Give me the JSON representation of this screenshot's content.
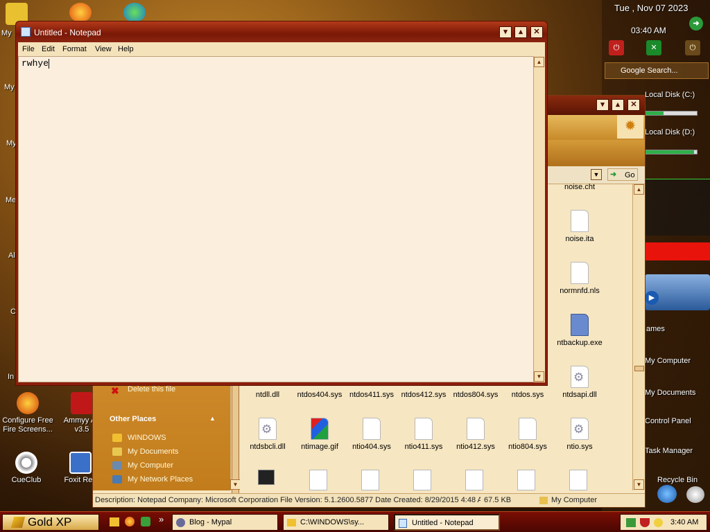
{
  "desktop": {
    "icons_left": [
      {
        "label": "My",
        "icon": "my-documents-icon"
      },
      {
        "label": "My",
        "icon": "my-computer-icon"
      },
      {
        "label": "My",
        "icon": "my-network-icon"
      },
      {
        "label": "Me",
        "icon": "media-icon"
      },
      {
        "label": "Al",
        "icon": "app-icon"
      },
      {
        "label": "C",
        "icon": "app-icon"
      },
      {
        "label": "In",
        "icon": "internet-icon"
      }
    ],
    "configure_fire": "Configure Free\nFire Screens...",
    "ammyy": "Ammyy Ad\nv3.5",
    "cueclub": "CueClub",
    "foxit": "Foxit Rea"
  },
  "sidebar": {
    "date": "Tue , Nov 07 2023",
    "time": "03:40 AM",
    "google_search": "Google Search...",
    "disk_c": "Local Disk (C:)",
    "disk_c_fill": 0.35,
    "disk_d": "Local Disk (D:)",
    "disk_d_fill": 0.95,
    "links": [
      "ames",
      "My Computer",
      "My Documents",
      "Control Panel",
      "Task Manager",
      "Recycle Bin"
    ]
  },
  "explorer": {
    "go_label": "Go",
    "tasks": {
      "delete_file": "Delete this file",
      "other_places_heading": "Other Places",
      "other_places": [
        "WINDOWS",
        "My Documents",
        "My Computer",
        "My Network Places"
      ]
    },
    "files_right_column": [
      {
        "name": "noise.cht",
        "kind": "doc"
      },
      {
        "name": "noise.ita",
        "kind": "doc"
      },
      {
        "name": "normnfd.nls",
        "kind": "doc"
      },
      {
        "name": "ntbackup.exe",
        "kind": "exe"
      }
    ],
    "files_row1": [
      "ntdll.dll",
      "ntdos404.sys",
      "ntdos411.sys",
      "ntdos412.sys",
      "ntdos804.sys",
      "ntdos.sys",
      "ntdsapi.dll"
    ],
    "files_row2": [
      "ntdsbcli.dll",
      "ntimage.gif",
      "ntio404.sys",
      "ntio411.sys",
      "ntio412.sys",
      "ntio804.sys",
      "ntio.sys"
    ],
    "status_description": "Description: Notepad Company: Microsoft Corporation File Version: 5.1.2600.5877 Date Created: 8/29/2015 4:48 A",
    "status_size": "67.5 KB",
    "status_location": "My Computer"
  },
  "notepad": {
    "title": "Untitled - Notepad",
    "menu": [
      "File",
      "Edit",
      "Format",
      "View",
      "Help"
    ],
    "content": "rwhye"
  },
  "taskbar": {
    "start_label": "Gold XP",
    "quicklaunch_more": "»",
    "buttons": [
      {
        "label": "Blog - Mypal"
      },
      {
        "label": "C:\\WINDOWS\\sy..."
      },
      {
        "label": "Untitled - Notepad",
        "active": true
      }
    ],
    "clock": "3:40 AM"
  }
}
